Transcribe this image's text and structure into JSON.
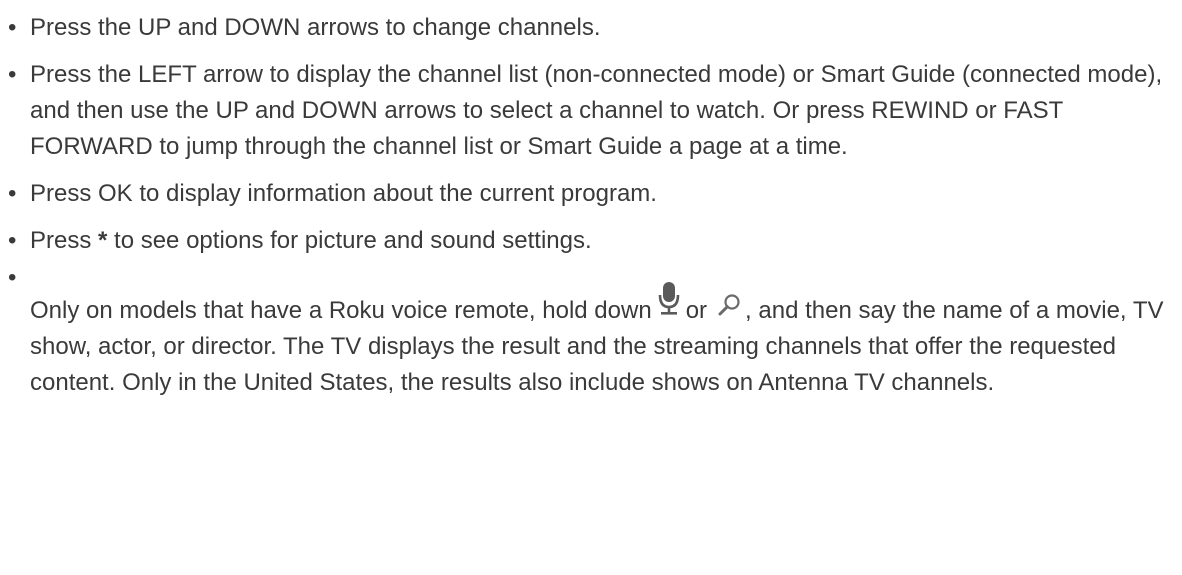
{
  "bullet_char": "•",
  "items": [
    {
      "text": "Press the UP and DOWN arrows to change channels."
    },
    {
      "text": "Press the LEFT arrow to display the channel list (non-connected mode) or Smart Guide (connected mode), and then use the UP and DOWN arrows to select a channel to watch. Or press REWIND or FAST FORWARD to jump through the channel list or Smart Guide a page at a time."
    },
    {
      "text": "Press OK to display information about the current program."
    },
    {
      "before": "Press ",
      "star": "*",
      "after": " to see options for picture and sound settings."
    },
    {
      "before_icons": "Only on models that have a Roku voice remote, hold down",
      "between_icons": "or",
      "after_icons": ", and then say the name of a movie, TV show, actor, or director. The TV displays the result and the streaming channels that offer the requested content. Only in the United States, the results also include shows on Antenna TV channels.",
      "icon1": "microphone-icon",
      "icon2": "magnifier-search-icon"
    }
  ],
  "colors": {
    "text": "#3a3a3a",
    "icon": "#5a5a5a"
  }
}
